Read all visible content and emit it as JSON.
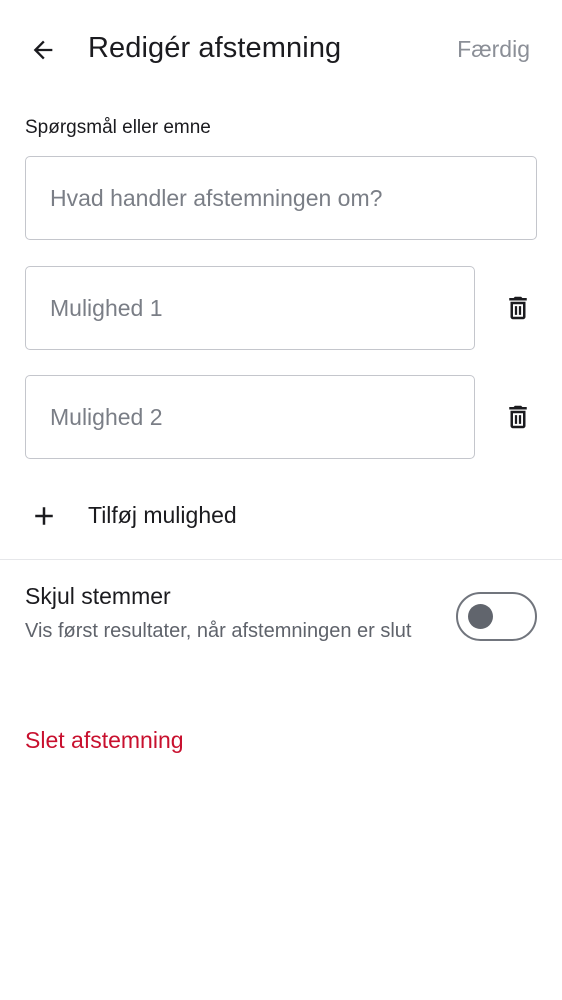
{
  "header": {
    "back_icon": "arrow-left-icon",
    "title": "Redigér afstemning",
    "done_label": "Færdig"
  },
  "question": {
    "label": "Spørgsmål eller emne",
    "placeholder": "Hvad handler afstemningen om?",
    "value": ""
  },
  "options": [
    {
      "placeholder": "Mulighed 1",
      "value": "",
      "delete_icon": "trash-icon"
    },
    {
      "placeholder": "Mulighed 2",
      "value": "",
      "delete_icon": "trash-icon"
    }
  ],
  "add_option": {
    "icon": "plus-icon",
    "label": "Tilføj mulighed"
  },
  "hide_votes": {
    "title": "Skjul stemmer",
    "description": "Vis først resultater, når afstemningen er slut",
    "enabled": false
  },
  "delete_poll_label": "Slet afstemning",
  "colors": {
    "text": "#1b1b1f",
    "muted": "#8b8f97",
    "secondary_text": "#5f636b",
    "border": "#c4c6cc",
    "danger": "#c8102e"
  }
}
